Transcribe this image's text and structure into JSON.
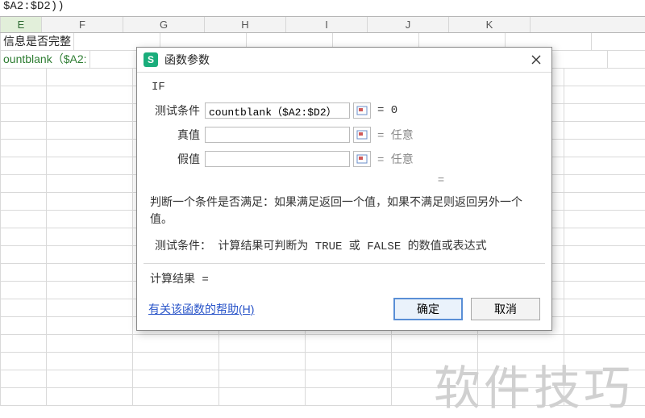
{
  "formula_bar": "$A2:$D2))",
  "columns_visible": [
    "E",
    "F",
    "G",
    "H",
    "I",
    "J",
    "K"
  ],
  "selected_column": "E",
  "cells": {
    "E1_cut": "信息是否完整",
    "E2_cut": "ountblank（$A2:"
  },
  "dialog": {
    "title": "函数参数",
    "func_name": "IF",
    "args": [
      {
        "label": "测试条件",
        "value": "countblank（$A2:$D2）",
        "result": "= 0",
        "result_strong": true
      },
      {
        "label": "真值",
        "value": "",
        "result": "= 任意",
        "result_strong": false
      },
      {
        "label": "假值",
        "value": "",
        "result": "= 任意",
        "result_strong": false
      }
    ],
    "eq_alone": "=",
    "description": "判断一个条件是否满足：如果满足返回一个值，如果不满足则返回另外一个值。",
    "arg_detail": "测试条件： 计算结果可判断为 TRUE 或 FALSE 的数值或表达式",
    "result_line": "计算结果 =",
    "help_link": "有关该函数的帮助(H)",
    "ok": "确定",
    "cancel": "取消"
  },
  "watermark": "软件技巧"
}
